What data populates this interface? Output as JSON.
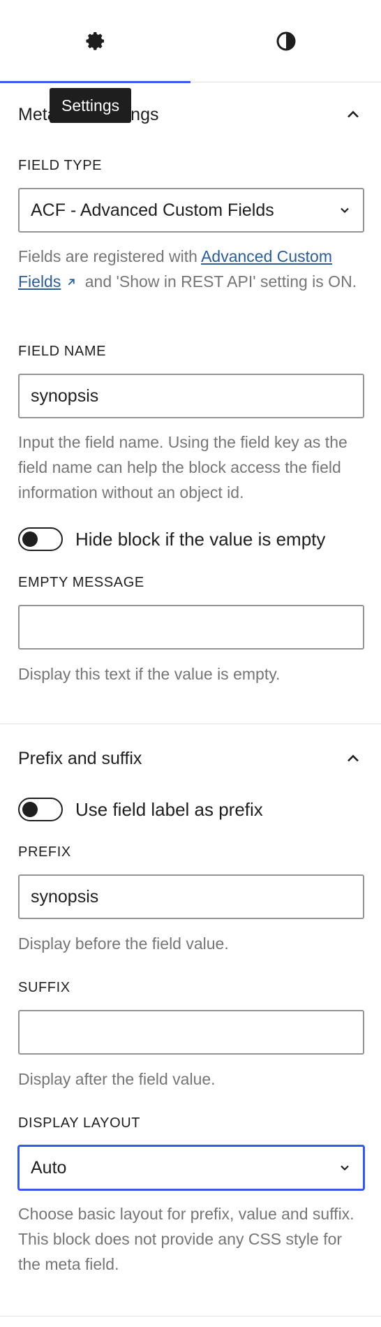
{
  "tabs": {
    "settings_icon": "gear-icon",
    "styles_icon": "half-circle-icon",
    "active": "settings"
  },
  "tooltip": {
    "text": "Settings"
  },
  "meta_panel": {
    "title": "Meta field settings",
    "field_type": {
      "label": "FIELD TYPE",
      "value": "ACF - Advanced Custom Fields",
      "help_prefix": "Fields are registered with ",
      "help_link": "Advanced Custom Fields",
      "help_suffix": " and 'Show in REST API' setting is ON."
    },
    "field_name": {
      "label": "FIELD NAME",
      "value": "synopsis",
      "help": "Input the field name. Using the field key as the field name can help the block access the field information without an object id."
    },
    "hide_toggle": {
      "label": "Hide block if the value is empty",
      "checked": false
    },
    "empty_message": {
      "label": "EMPTY MESSAGE",
      "value": "",
      "help": "Display this text if the value is empty."
    }
  },
  "prefix_panel": {
    "title": "Prefix and suffix",
    "label_toggle": {
      "label": "Use field label as prefix",
      "checked": false
    },
    "prefix": {
      "label": "PREFIX",
      "value": "synopsis",
      "help": "Display before the field value."
    },
    "suffix": {
      "label": "SUFFIX",
      "value": "",
      "help": "Display after the field value."
    },
    "display_layout": {
      "label": "DISPLAY LAYOUT",
      "value": "Auto",
      "help": "Choose basic layout for prefix, value and suffix. This block does not provide any CSS style for the meta field."
    }
  },
  "colors": {
    "accent": "#3858e9",
    "link": "#2c5c93",
    "help_text": "#757575",
    "text": "#1e1e1e"
  }
}
